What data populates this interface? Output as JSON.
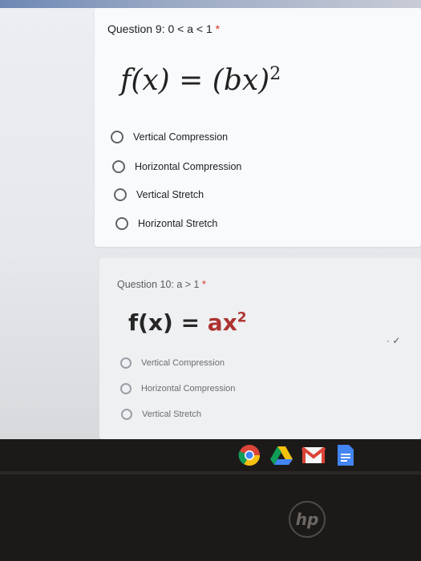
{
  "question9": {
    "title": "Question 9: 0 < a < 1",
    "required_mark": "*",
    "formula_main": "f(x) = (bx)",
    "formula_exp": "2",
    "options": [
      "Vertical Compression",
      "Horizontal Compression",
      "Vertical Stretch",
      "Horizontal Stretch"
    ]
  },
  "question10": {
    "title": "Question 10: a > 1",
    "required_mark": "*",
    "formula_lhs": "f(x) = ",
    "formula_rhs": "ax",
    "formula_exp": "2",
    "options": [
      "Vertical Compression",
      "Horizontal Compression",
      "Vertical Stretch"
    ]
  },
  "dock": {
    "apps": [
      "chrome-icon",
      "drive-icon",
      "gmail-icon",
      "docs-icon"
    ]
  },
  "device": {
    "logo": "hp"
  },
  "colors": {
    "required": "#d93025",
    "card": "#f9fafc"
  }
}
